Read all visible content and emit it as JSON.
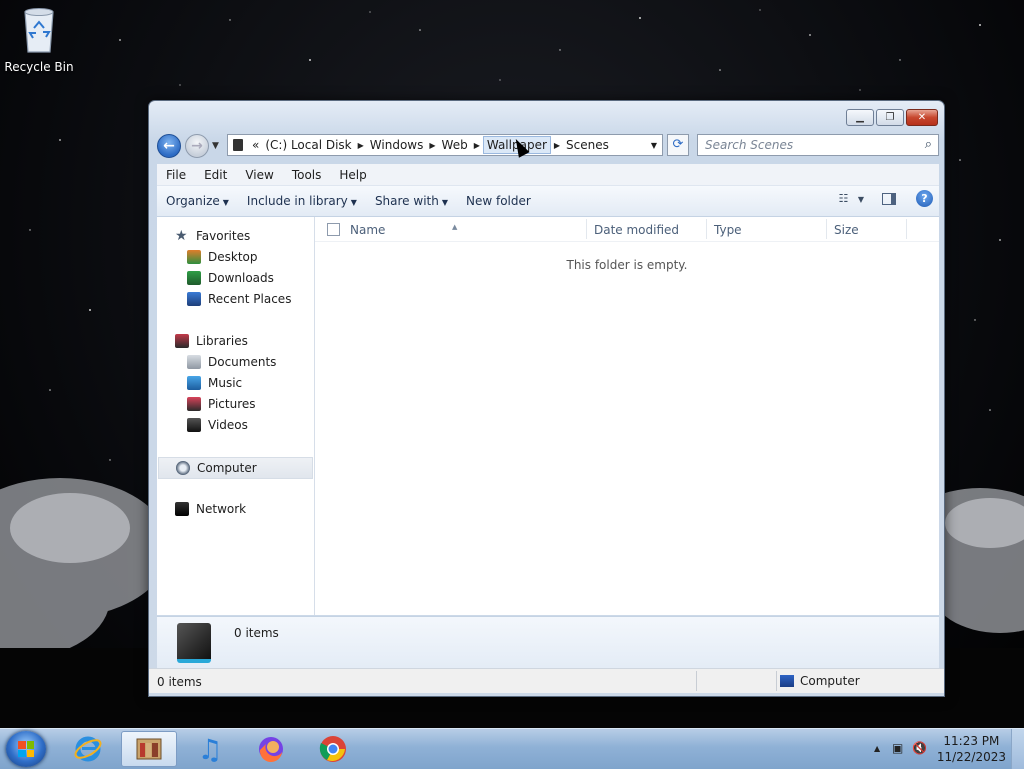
{
  "desktop": {
    "icons": [
      {
        "label": "Recycle Bin"
      }
    ]
  },
  "window": {
    "address": {
      "history_glyph": "«",
      "crumbs": [
        "(C:) Local Disk",
        "Windows",
        "Web",
        "Wallpaper",
        "Scenes"
      ]
    },
    "search": {
      "placeholder": "Search Scenes"
    },
    "menu": [
      "File",
      "Edit",
      "View",
      "Tools",
      "Help"
    ],
    "toolbar": {
      "organize": "Organize",
      "include_in_library": "Include in library",
      "share_with": "Share with",
      "new_folder": "New folder"
    },
    "nav": {
      "favorites": "Favorites",
      "favorites_items": [
        "Desktop",
        "Downloads",
        "Recent Places"
      ],
      "libraries": "Libraries",
      "libraries_items": [
        "Documents",
        "Music",
        "Pictures",
        "Videos"
      ],
      "computer": "Computer",
      "network": "Network"
    },
    "columns": {
      "name": "Name",
      "date_modified": "Date modified",
      "type": "Type",
      "size": "Size"
    },
    "empty_message": "This folder is empty.",
    "details": {
      "count": "0 items"
    },
    "status": {
      "items": "0 items",
      "location": "Computer"
    }
  },
  "taskbar": {
    "clock": {
      "time": "11:23 PM",
      "date": "11/22/2023"
    }
  },
  "colors": {
    "accent": "#2d6bc4",
    "taskbar": "#8fb1d6"
  }
}
